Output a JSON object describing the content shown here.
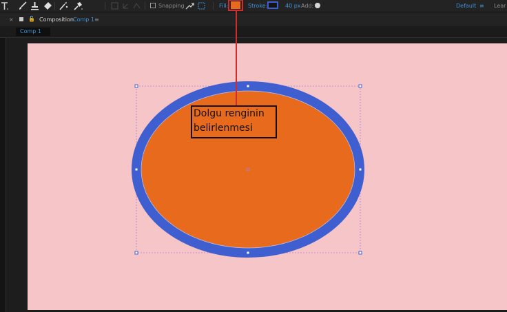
{
  "toolbar": {
    "tools": [
      "type-tool",
      "brush-tool",
      "clone-stamp-tool",
      "eraser-tool",
      "roto-brush-tool",
      "puppet-pin-tool"
    ],
    "snapping_label": "Snapping",
    "fill_label": "Fill:",
    "fill_color": "#e86a1c",
    "stroke_label": "Stroke:",
    "stroke_color": "#3f5fd0",
    "stroke_width": "40 px",
    "add_label": "Add:",
    "workspace_label": "Default",
    "learn_label": "Lear"
  },
  "panel": {
    "title": "Composition",
    "comp_name": "Comp 1",
    "tab_label": "Comp 1"
  },
  "canvas": {
    "background": "#f5c5c8",
    "ellipse_fill": "#e86a1c",
    "ellipse_stroke": "#3f5fd0"
  },
  "annotation": {
    "text": "Dolgu renginin belirlenmesi"
  }
}
